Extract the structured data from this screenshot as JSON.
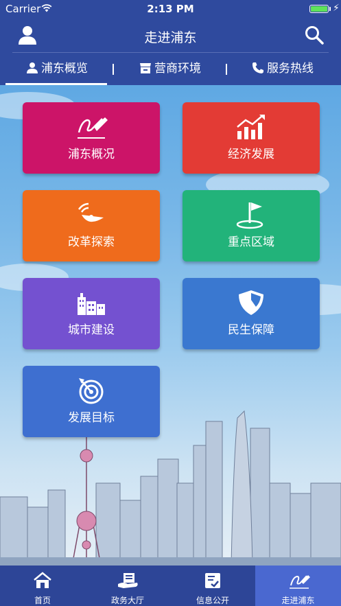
{
  "status_bar": {
    "carrier": "Carrier",
    "time": "2:13 PM",
    "battery_level": 1.0
  },
  "header": {
    "title": "走进浦东"
  },
  "sub_tabs": [
    {
      "label": "浦东概览",
      "icon": "person-icon",
      "active": true
    },
    {
      "label": "营商环境",
      "icon": "store-icon",
      "active": false
    },
    {
      "label": "服务热线",
      "icon": "phone-icon",
      "active": false
    }
  ],
  "sub_tab_separator": "|",
  "tiles": [
    {
      "label": "浦东概况",
      "icon": "signature-pen-icon",
      "color": "#cc1468"
    },
    {
      "label": "经济发展",
      "icon": "growth-chart-icon",
      "color": "#e33b35"
    },
    {
      "label": "改革探索",
      "icon": "satellite-dish-icon",
      "color": "#ef6b1c"
    },
    {
      "label": "重点区域",
      "icon": "location-flag-icon",
      "color": "#22b37a"
    },
    {
      "label": "城市建设",
      "icon": "buildings-icon",
      "color": "#7451d0"
    },
    {
      "label": "民生保障",
      "icon": "shield-icon",
      "color": "#3a78d0"
    },
    {
      "label": "发展目标",
      "icon": "target-icon",
      "color": "#3e6fd0"
    }
  ],
  "bottom_tabs": [
    {
      "label": "首页",
      "icon": "home-icon",
      "active": false
    },
    {
      "label": "政务大厅",
      "icon": "hand-document-icon",
      "active": false
    },
    {
      "label": "信息公开",
      "icon": "checklist-icon",
      "active": false
    },
    {
      "label": "走进浦东",
      "icon": "signature-pen-icon",
      "active": true
    }
  ],
  "colors": {
    "header": "#2f4a9e",
    "tab_bar": "#2d4597",
    "active_tab": "#4a68d0"
  }
}
